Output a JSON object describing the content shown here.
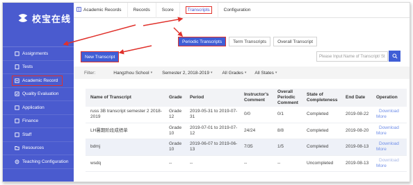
{
  "app": {
    "logo_text": "校宝在线"
  },
  "sidebar": {
    "items": [
      {
        "label": "Assignments",
        "icon": "clipboard-icon"
      },
      {
        "label": "Tests",
        "icon": "document-icon"
      },
      {
        "label": "Academic Record",
        "icon": "record-icon",
        "active": true
      },
      {
        "label": "Quality Evaluation",
        "icon": "check-icon"
      },
      {
        "label": "Application",
        "icon": "form-icon"
      },
      {
        "label": "Finance",
        "icon": "finance-icon"
      },
      {
        "label": "Staff",
        "icon": "people-icon"
      },
      {
        "label": "Resources",
        "icon": "folder-icon"
      },
      {
        "label": "Teaching Configuration",
        "icon": "gear-icon"
      }
    ]
  },
  "topbar": {
    "tabs": [
      {
        "label": "Academic Records"
      },
      {
        "label": "Records"
      },
      {
        "label": "Score"
      },
      {
        "label": "Transcripts",
        "active": true
      },
      {
        "label": "Configuration"
      }
    ]
  },
  "subtabs": [
    {
      "label": "Periodic Transcripts",
      "active": true
    },
    {
      "label": "Term Transcripts"
    },
    {
      "label": "Overall Transcript"
    }
  ],
  "toolbar": {
    "new_button": "New Transcript",
    "search_placeholder": "Please Input Name of Transcript/ St"
  },
  "filters": {
    "label": "Filter:",
    "school": "Hangzhou School",
    "semester": "Semester 2, 2018-2019",
    "grades": "All Grades",
    "states": "All States"
  },
  "table": {
    "headers": {
      "name": "Name of Transcript",
      "grade": "Grade",
      "period": "Period",
      "instructor_1": "Instructor's",
      "instructor_2": "Comment",
      "overall_1": "Overall",
      "overall_2": "Periodic",
      "overall_3": "Comment",
      "state_1": "State of",
      "state_2": "Completeness",
      "end_date": "End Date",
      "operation": "Operation"
    },
    "rows": [
      {
        "name": "russ 3B transcript semester 2 2018-2019",
        "grade_1": "Grade",
        "grade_2": "12",
        "period": "2019-05-31 to 2019-07-31",
        "instructor": "0/0",
        "overall": "0/1",
        "state": "Completed",
        "end_date": "2019-08-22",
        "download": "Download",
        "more": "More"
      },
      {
        "name": "LH暑期阶段成绩单",
        "grade_1": "Grade",
        "grade_2": "10",
        "period": "2019-07-01 to 2019-07-12",
        "instructor": "24/24",
        "overall": "8/8",
        "state": "Completed",
        "end_date": "2019-08-20",
        "download": "Download",
        "more": "More"
      },
      {
        "name": "bdmj",
        "grade_1": "Grade",
        "grade_2": "10",
        "period": "2019-06-07 to 2019-06-13",
        "instructor": "7/35",
        "overall": "1/5",
        "state": "Completed",
        "end_date": "2019-08-13",
        "download": "Download",
        "more": "More"
      },
      {
        "name": "wsdq",
        "grade_1": "--",
        "grade_2": "",
        "period": "--",
        "instructor": "--",
        "overall": "--",
        "state": "Uncompleted",
        "end_date": "2019-08-13",
        "download": "Download",
        "more": "More"
      }
    ]
  },
  "colors": {
    "sidebar": "#4a5bcf",
    "accent": "#3f5ed6",
    "annotation": "#e0312b",
    "link": "#6f8ee8"
  }
}
